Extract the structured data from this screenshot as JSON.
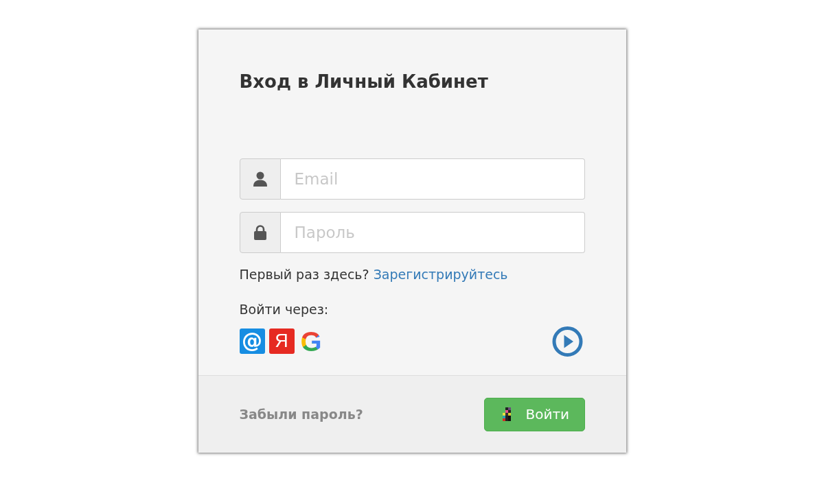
{
  "title": "Вход в Личный Кабинет",
  "fields": [
    {
      "kind": "email",
      "placeholder": "Email"
    },
    {
      "kind": "password",
      "placeholder": "Пароль"
    }
  ],
  "register": {
    "prompt": "Первый раз здесь?",
    "link": "Зарегистрируйтесь"
  },
  "social_login": {
    "label": "Войти через:",
    "providers": [
      {
        "kind": "mail",
        "glyph": "@"
      },
      {
        "kind": "yandex",
        "glyph": "Я"
      },
      {
        "kind": "google",
        "glyph": "G"
      }
    ]
  },
  "footer": {
    "forgot_link": "Забыли пароль?",
    "submit_button": "Войти"
  }
}
